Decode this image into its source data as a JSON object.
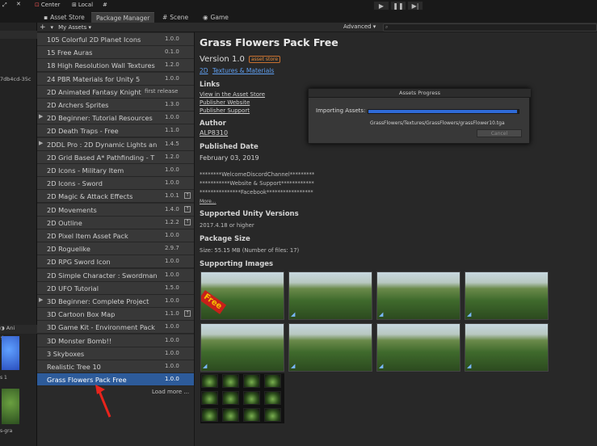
{
  "toolbar": {
    "center": "Center",
    "local": "Local"
  },
  "tabs": [
    {
      "label": "Asset Store"
    },
    {
      "label": "Package Manager"
    },
    {
      "label": "Scene"
    },
    {
      "label": "Game"
    }
  ],
  "left_strip": {
    "id_fragment": "7db4cd-35c",
    "anim_tab": "Ani",
    "label1": "s 1",
    "label2": "s-gra"
  },
  "list": {
    "add_button": "+",
    "filter": "My Assets",
    "items": [
      {
        "name": "105 Colorful 2D Planet Icons",
        "version": "1.0.0"
      },
      {
        "name": "15 Free Auras",
        "version": "0.1.0"
      },
      {
        "name": "18 High Resolution Wall Textures",
        "version": "1.2.0"
      },
      {
        "name": "24 PBR Materials for Unity 5",
        "version": "1.0.0"
      },
      {
        "name": "2D Animated Fantasy Knight",
        "version": "first release"
      },
      {
        "name": "2D Archers Sprites",
        "version": "1.3.0"
      },
      {
        "name": "2D Beginner: Tutorial Resources",
        "version": "1.0.0"
      },
      {
        "name": "2D Death Traps - Free",
        "version": "1.1.0"
      },
      {
        "name": "2DDL Pro : 2D Dynamic Lights an",
        "version": "1.4.5"
      },
      {
        "name": "2D Grid Based A* Pathfinding - T",
        "version": "1.2.0"
      },
      {
        "name": "2D Icons - Military Item",
        "version": "1.0.0"
      },
      {
        "name": "2D Icons - Sword",
        "version": "1.0.0"
      },
      {
        "name": "2D Magic & Attack Effects",
        "version": "1.0.1"
      },
      {
        "name": "2D Movements",
        "version": "1.4.0"
      },
      {
        "name": "2D Outline",
        "version": "1.2.2"
      },
      {
        "name": "2D Pixel Item Asset Pack",
        "version": "1.0.0"
      },
      {
        "name": "2D Roguelike",
        "version": "2.9.7"
      },
      {
        "name": "2D RPG Sword Icon",
        "version": "1.0.0"
      },
      {
        "name": "2D Simple Character : Swordman",
        "version": "1.0.0"
      },
      {
        "name": "2D UFO Tutorial",
        "version": "1.5.0"
      },
      {
        "name": "3D Beginner: Complete Project",
        "version": "1.0.0"
      },
      {
        "name": "3D Cartoon Box Map",
        "version": "1.1.0"
      },
      {
        "name": "3D Game Kit - Environment Pack",
        "version": "1.0.0"
      },
      {
        "name": "3D Monster Bomb!!",
        "version": "1.0.0"
      },
      {
        "name": "3 Skyboxes",
        "version": "1.0.0"
      },
      {
        "name": "Realistic Tree 10",
        "version": "1.0.0"
      },
      {
        "name": "Grass Flowers Pack Free",
        "version": "1.0.0"
      }
    ],
    "load_more": "Load more ..."
  },
  "detail": {
    "advanced": "Advanced",
    "title": "Grass Flowers Pack Free",
    "version": "Version 1.0",
    "badge": "asset store",
    "cat1": "2D",
    "cat2": "Textures & Materials",
    "links_h": "Links",
    "link1": "View in the Asset Store",
    "link2": "Publisher Website",
    "link3": "Publisher Support",
    "author_h": "Author",
    "author": "ALP8310",
    "published_h": "Published Date",
    "published": "February 03,  2019",
    "desc1": "********WelcomeDiscordChannel*********",
    "desc2": "***********Website & Support************",
    "desc3": "***************Facebook*****************",
    "more": "More...",
    "unity_h": "Supported Unity Versions",
    "unity": "2017.4.18 or higher",
    "size_h": "Package Size",
    "size": "Size: 55.15 MB (Number of files: 17)",
    "images_h": "Supporting Images",
    "free_label": "Free"
  },
  "dialog": {
    "title": "Assets Progress",
    "label": "Importing Assets:",
    "progress": 0.99,
    "path": "GrassFlowers/Textures/GrassFlowers/grassFlower10.tga",
    "cancel": "Cancel"
  }
}
